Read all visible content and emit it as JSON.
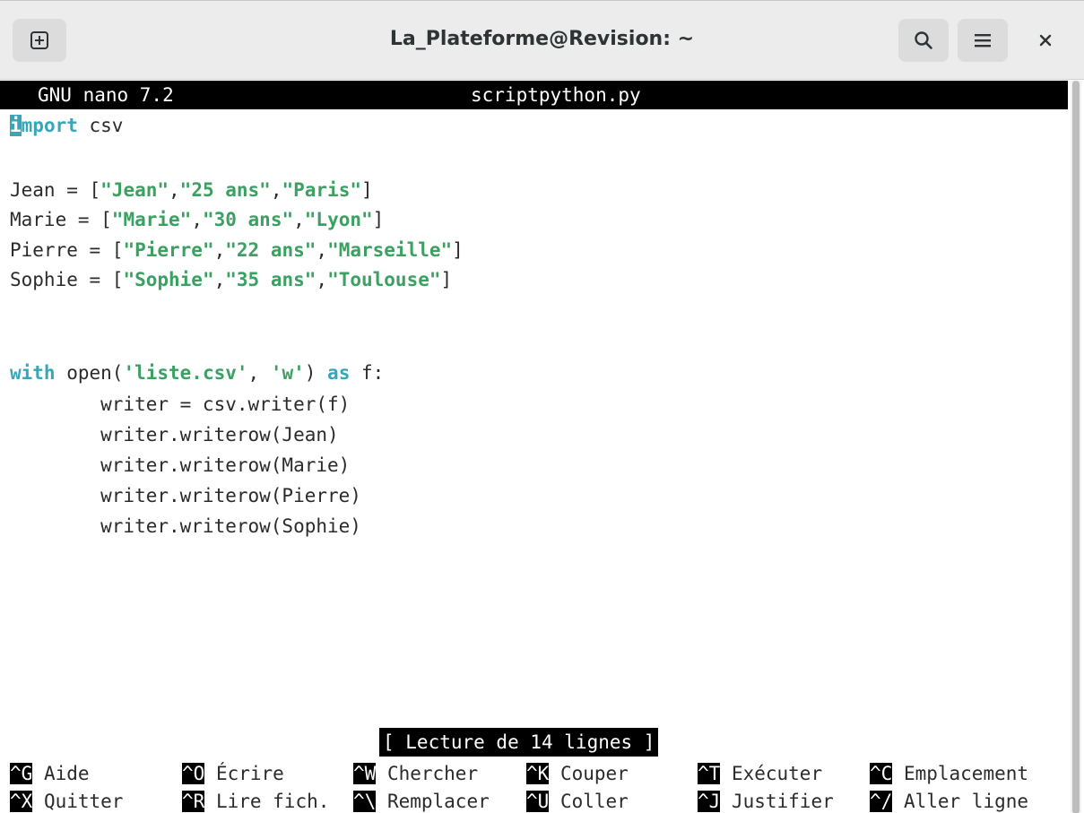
{
  "window": {
    "title": "La_Plateforme@Revision: ~",
    "icons": {
      "new_tab": "new-tab-icon",
      "search": "search-icon",
      "menu": "hamburger-menu-icon",
      "close": "close-icon"
    }
  },
  "nano": {
    "version": "GNU nano 7.2",
    "filename": "scriptpython.py",
    "status": "[ Lecture de 14 lignes ]"
  },
  "code": {
    "l1": {
      "cursor_char": "i",
      "keyword_rest": "mport",
      "rest": " csv"
    },
    "l3": {
      "name": "Jean",
      "op": " = [",
      "s1": "\"Jean\"",
      "s2": "\"25 ans\"",
      "s3": "\"Paris\"",
      "comma": ",",
      "close": "]"
    },
    "l4": {
      "name": "Marie",
      "op": " = [",
      "s1": "\"Marie\"",
      "s2": "\"30 ans\"",
      "s3": "\"Lyon\"",
      "comma": ",",
      "close": "]"
    },
    "l5": {
      "name": "Pierre",
      "op": " = [",
      "s1": "\"Pierre\"",
      "s2": "\"22 ans\"",
      "s3": "\"Marseille\"",
      "comma": ",",
      "close": "]"
    },
    "l6": {
      "name": "Sophie",
      "op": " = [",
      "s1": "\"Sophie\"",
      "s2": "\"35 ans\"",
      "s3": "\"Toulouse\"",
      "comma": ",",
      "close": "]"
    },
    "l9": {
      "kw_with": "with",
      "open": " open(",
      "arg1": "'liste.csv'",
      "sep": ", ",
      "arg2": "'w'",
      "paren": ") ",
      "kw_as": "as",
      "tail": " f:"
    },
    "l10": "        writer = csv.writer(f)",
    "l11": "        writer.writerow(Jean)",
    "l12": "        writer.writerow(Marie)",
    "l13": "        writer.writerow(Pierre)",
    "l14": "        writer.writerow(Sophie)"
  },
  "shortcuts": {
    "row1": [
      {
        "key": "^G",
        "label": " Aide"
      },
      {
        "key": "^O",
        "label": " Écrire"
      },
      {
        "key": "^W",
        "label": " Chercher"
      },
      {
        "key": "^K",
        "label": " Couper"
      },
      {
        "key": "^T",
        "label": " Exécuter"
      },
      {
        "key": "^C",
        "label": " Emplacement"
      }
    ],
    "row2": [
      {
        "key": "^X",
        "label": " Quitter"
      },
      {
        "key": "^R",
        "label": " Lire fich."
      },
      {
        "key": "^\\",
        "label": " Remplacer"
      },
      {
        "key": "^U",
        "label": " Coller"
      },
      {
        "key": "^J",
        "label": " Justifier"
      },
      {
        "key": "^/",
        "label": " Aller ligne"
      }
    ]
  },
  "colors": {
    "keyword": "#35a7b8",
    "string": "#3ba061",
    "bar": "#000000"
  }
}
